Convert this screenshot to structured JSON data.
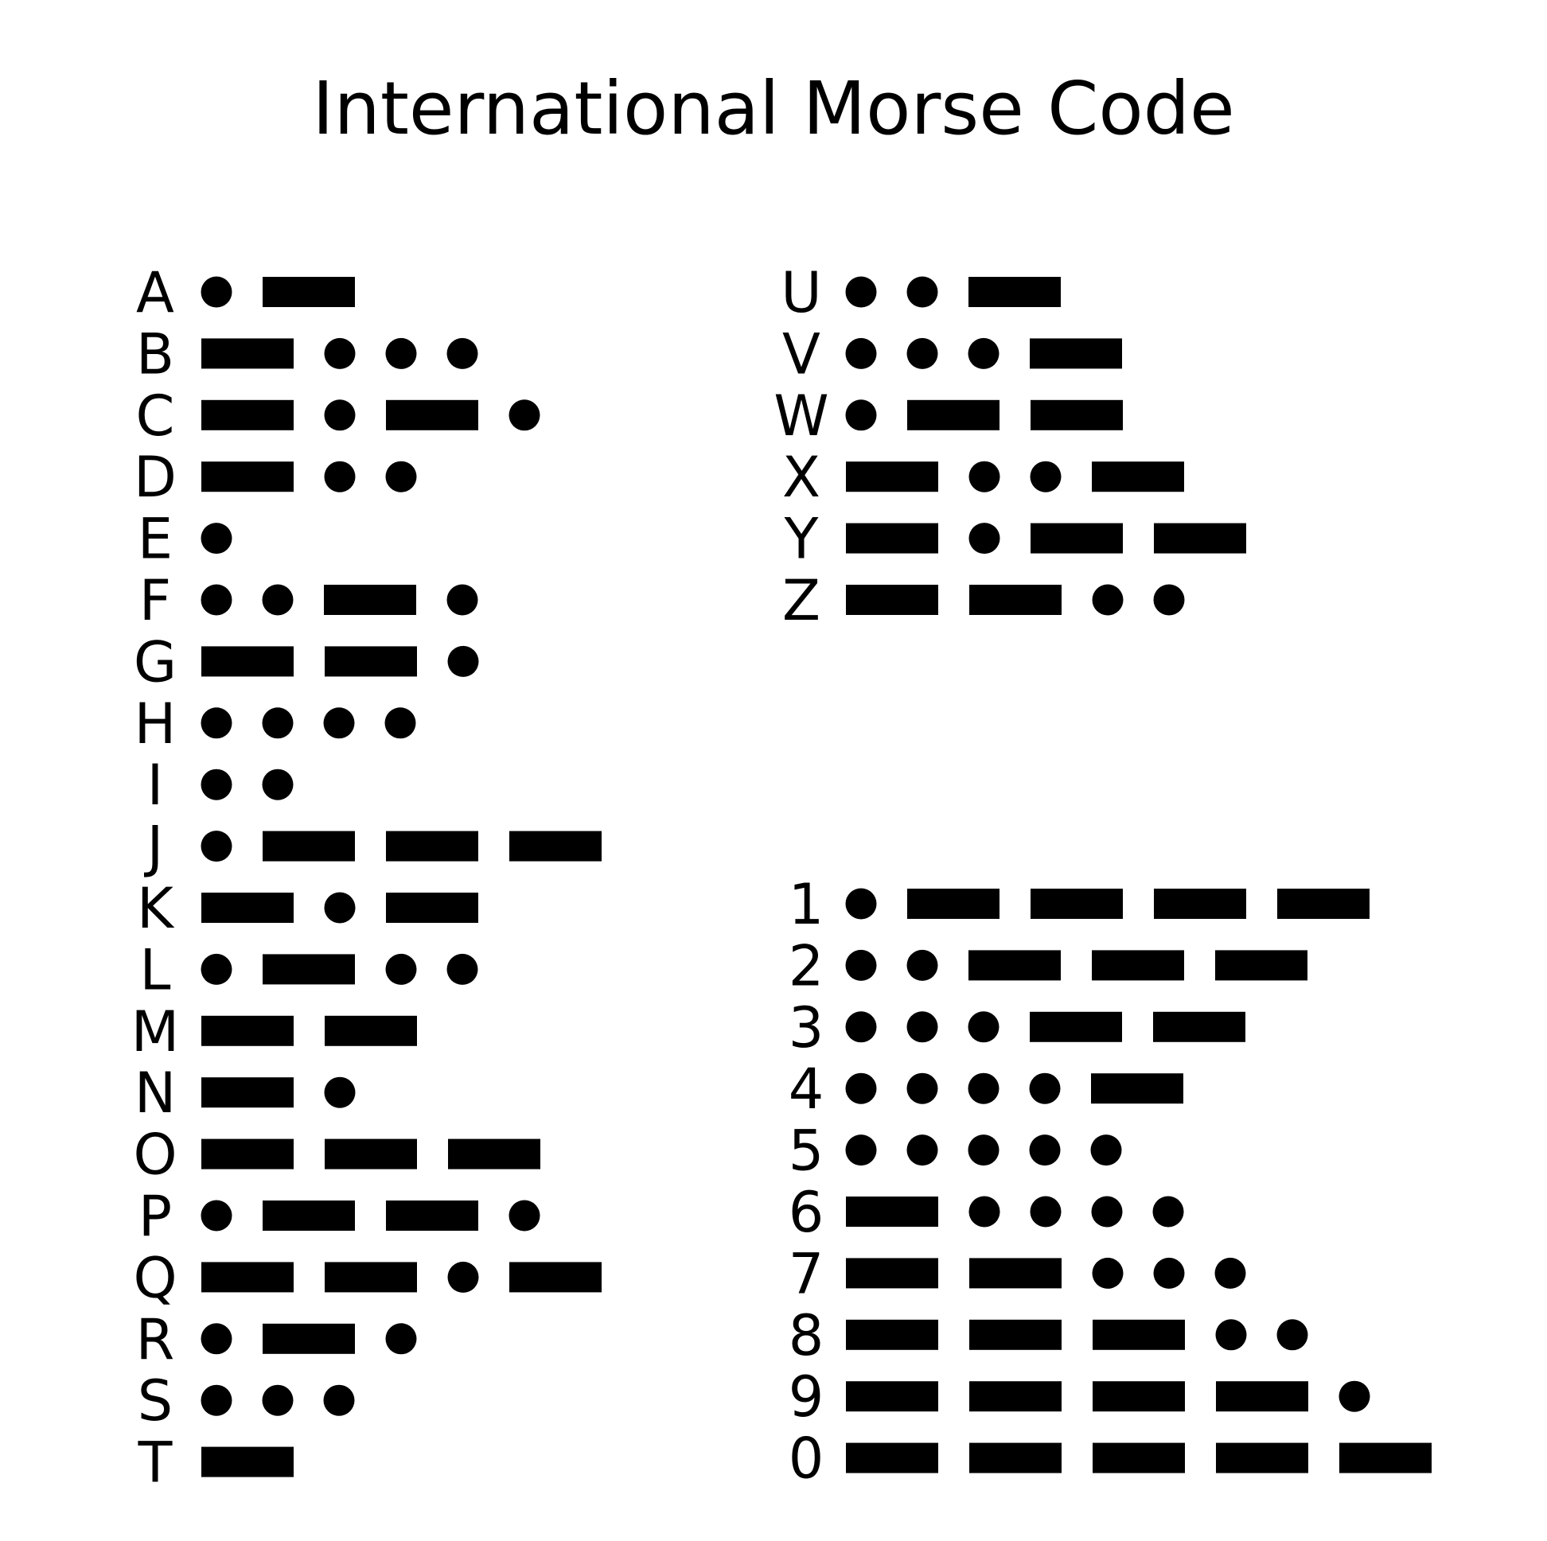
{
  "title": "International Morse Code",
  "colors": {
    "background": "#ffffff",
    "ink": "#000000"
  },
  "letters_a_to_t": [
    {
      "char": "A",
      "code": ".-"
    },
    {
      "char": "B",
      "code": "-..."
    },
    {
      "char": "C",
      "code": "-.-."
    },
    {
      "char": "D",
      "code": "-.."
    },
    {
      "char": "E",
      "code": "."
    },
    {
      "char": "F",
      "code": "..-."
    },
    {
      "char": "G",
      "code": "--."
    },
    {
      "char": "H",
      "code": "...."
    },
    {
      "char": "I",
      "code": ".."
    },
    {
      "char": "J",
      "code": ".---"
    },
    {
      "char": "K",
      "code": "-.-"
    },
    {
      "char": "L",
      "code": ".-.."
    },
    {
      "char": "M",
      "code": "--"
    },
    {
      "char": "N",
      "code": "-."
    },
    {
      "char": "O",
      "code": "---"
    },
    {
      "char": "P",
      "code": ".--."
    },
    {
      "char": "Q",
      "code": "--.-"
    },
    {
      "char": "R",
      "code": ".-."
    },
    {
      "char": "S",
      "code": "..."
    },
    {
      "char": "T",
      "code": "-"
    }
  ],
  "letters_u_to_z": [
    {
      "char": "U",
      "code": "..-"
    },
    {
      "char": "V",
      "code": "...-"
    },
    {
      "char": "W",
      "code": ".--"
    },
    {
      "char": "X",
      "code": "-..-"
    },
    {
      "char": "Y",
      "code": "-.--"
    },
    {
      "char": "Z",
      "code": "--.."
    }
  ],
  "digits": [
    {
      "char": "1",
      "code": ".----"
    },
    {
      "char": "2",
      "code": "..---"
    },
    {
      "char": "3",
      "code": "...--"
    },
    {
      "char": "4",
      "code": "....-"
    },
    {
      "char": "5",
      "code": "....."
    },
    {
      "char": "6",
      "code": "-...."
    },
    {
      "char": "7",
      "code": "--..."
    },
    {
      "char": "8",
      "code": "---.."
    },
    {
      "char": "9",
      "code": "----."
    },
    {
      "char": "0",
      "code": "-----"
    }
  ]
}
